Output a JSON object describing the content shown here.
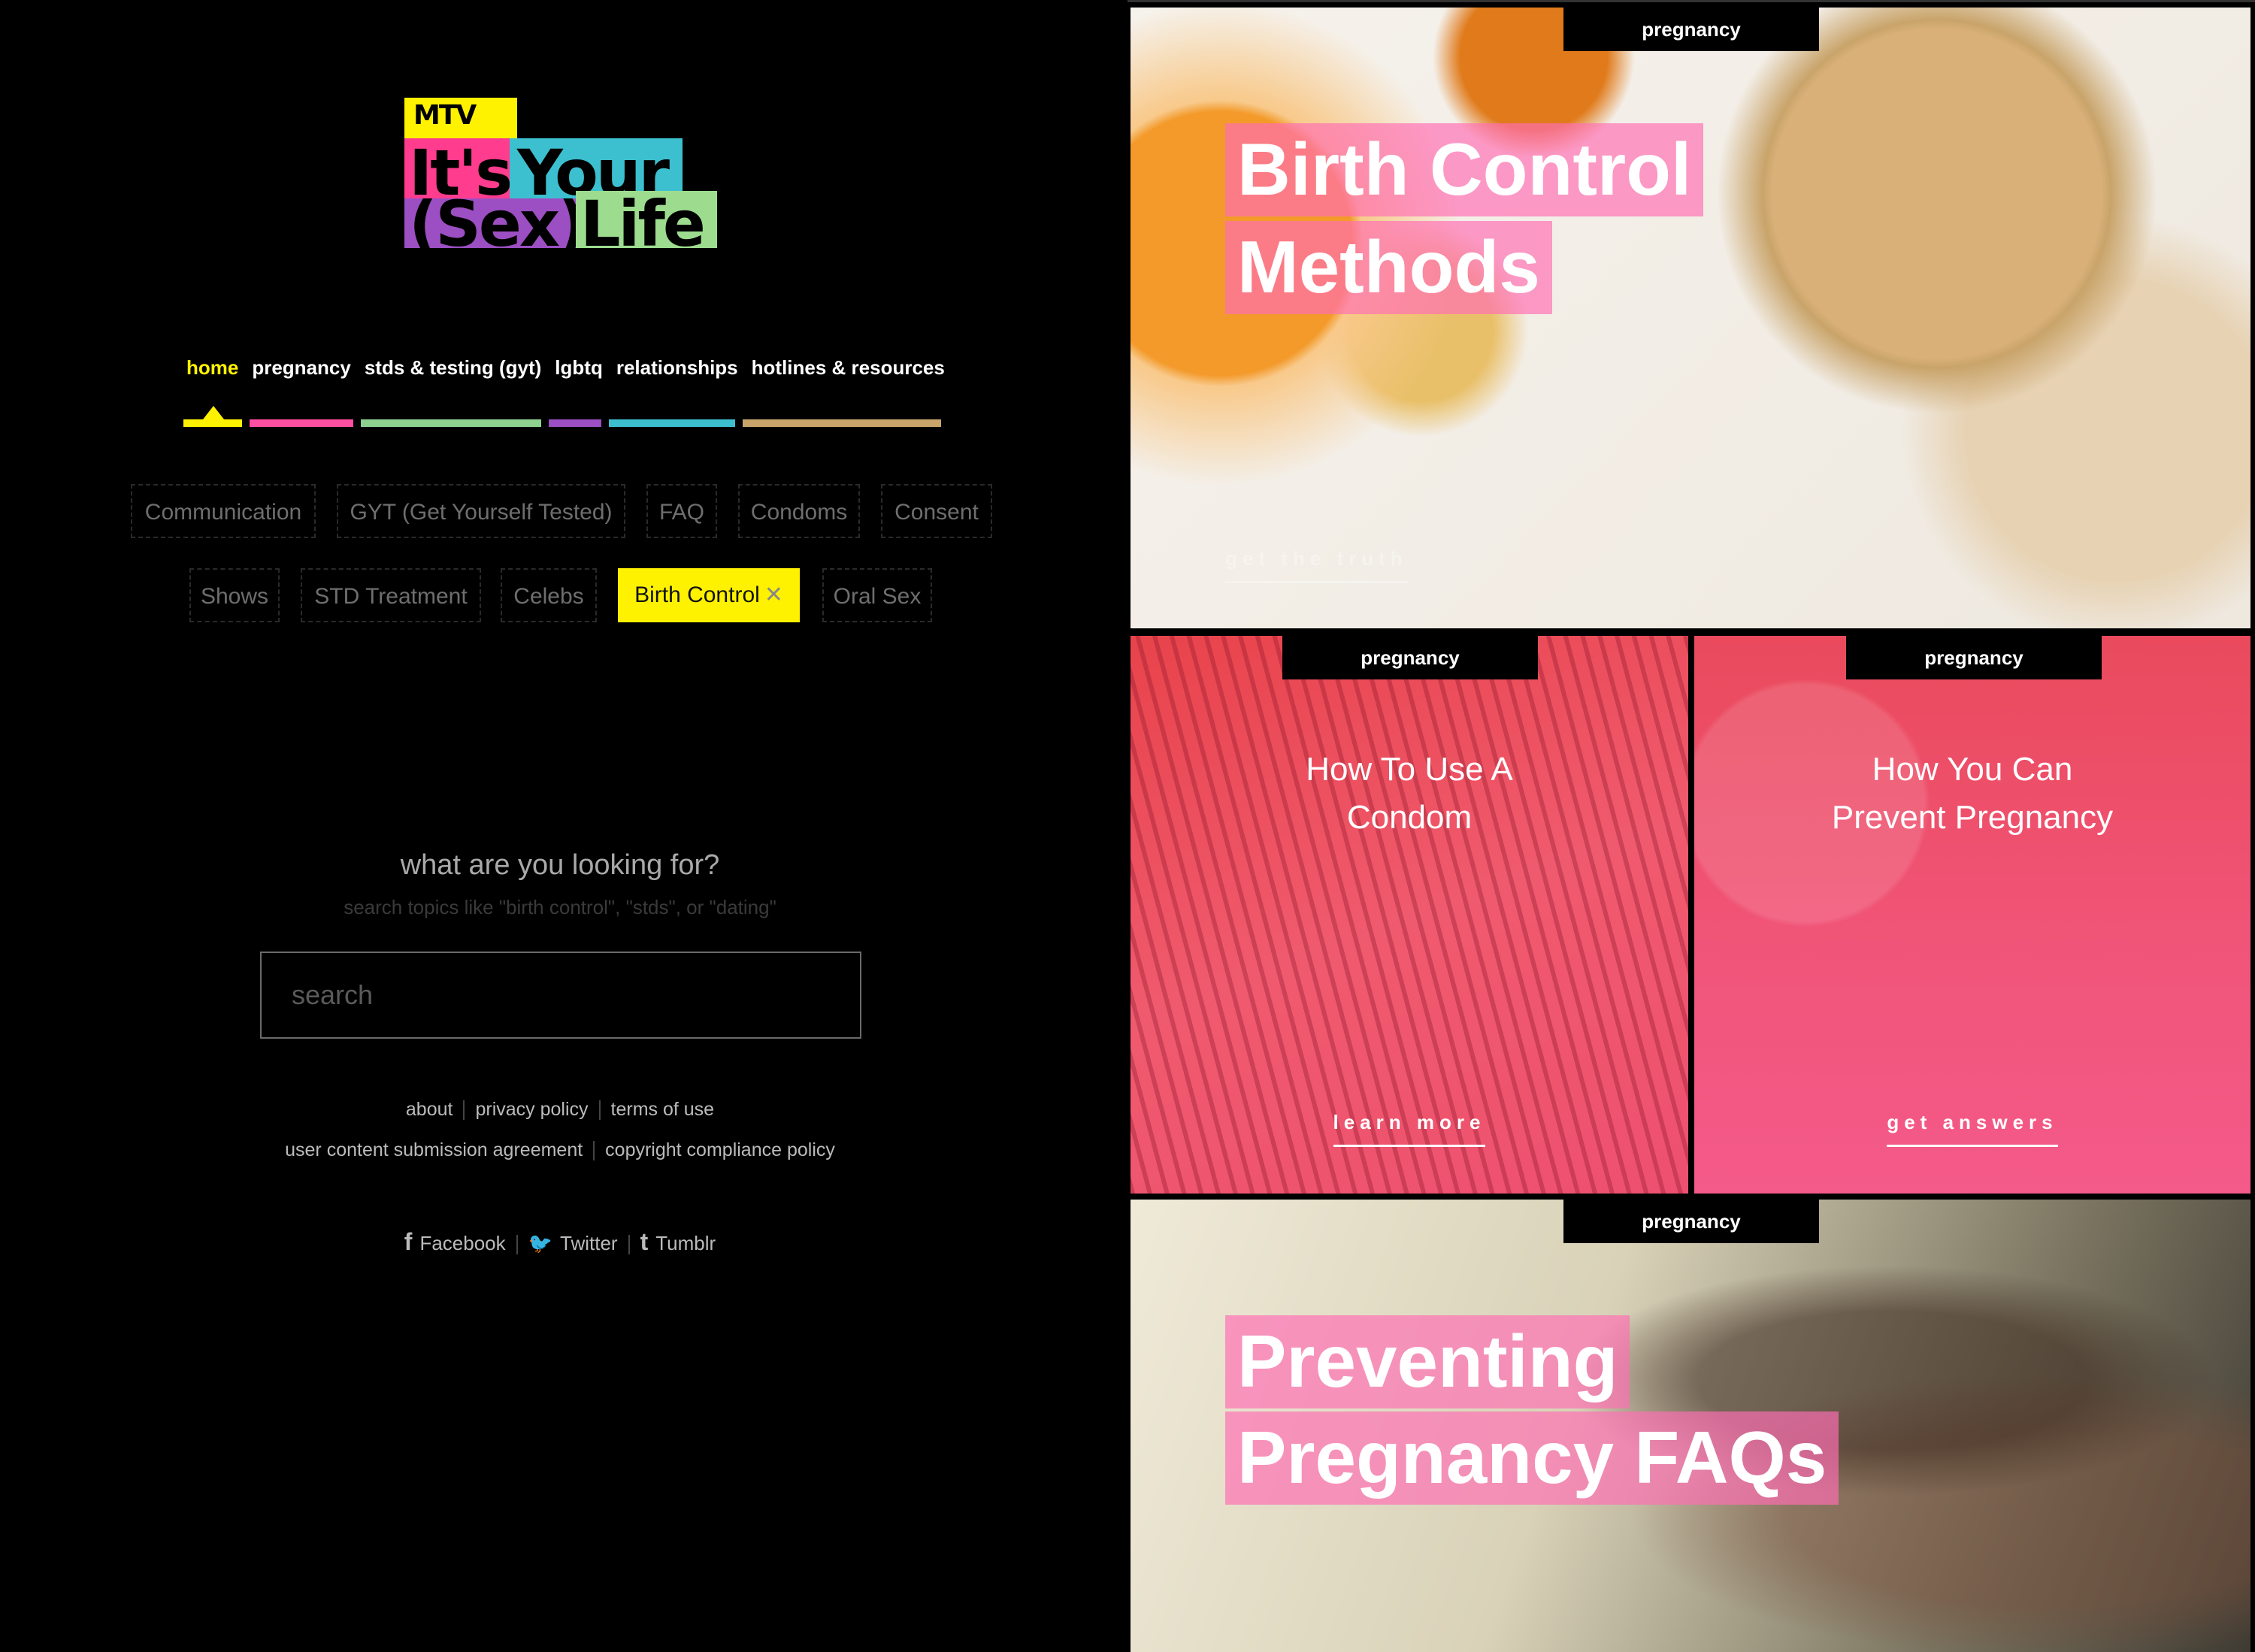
{
  "logo": {
    "brand": "MTV",
    "line1a": "It's",
    "line1b": "Your",
    "line2a": "(Sex)",
    "line2b": "Life",
    "colors": {
      "yellow": "#fff200",
      "pink": "#ff3c8d",
      "teal": "#3cc0cf",
      "purple": "#9b4fc2",
      "green": "#9ddc8f"
    }
  },
  "nav": {
    "items": [
      {
        "label": "home",
        "color": "#fff200",
        "active": true
      },
      {
        "label": "pregnancy",
        "color": "#ff4fa0"
      },
      {
        "label": "stds & testing (gyt)",
        "color": "#8fd18f"
      },
      {
        "label": "lgbtq",
        "color": "#9b4fc2"
      },
      {
        "label": "relationships",
        "color": "#3cc0cf"
      },
      {
        "label": "hotlines & resources",
        "color": "#c8a46a"
      }
    ]
  },
  "tags": {
    "row1": [
      "Communication",
      "GYT (Get Yourself Tested)",
      "FAQ",
      "Condoms",
      "Consent"
    ],
    "row2": [
      "Shows",
      "STD Treatment",
      "Celebs",
      "Birth Control",
      "Oral Sex"
    ],
    "selected": "Birth Control",
    "remove_symbol": "✕"
  },
  "search": {
    "heading": "what are you looking for?",
    "hint": "search topics like \"birth control\", \"stds\", or \"dating\"",
    "placeholder": "search"
  },
  "footer": {
    "about": "about",
    "privacy": "privacy policy",
    "terms": "terms of use",
    "ucsa": "user content submission agreement",
    "copyright": "copyright compliance policy",
    "social": [
      {
        "icon": "facebook-icon",
        "glyph": "f",
        "label": "Facebook"
      },
      {
        "icon": "twitter-icon",
        "glyph": "🐦",
        "label": "Twitter"
      },
      {
        "icon": "tumblr-icon",
        "glyph": "t",
        "label": "Tumblr"
      }
    ]
  },
  "cards": {
    "c1": {
      "badge": "pregnancy",
      "title1": "Birth Control",
      "title2": "Methods",
      "cta": "get the truth"
    },
    "c2": {
      "badge": "pregnancy",
      "title1": "How To Use A",
      "title2": "Condom",
      "cta": "learn more"
    },
    "c3": {
      "badge": "pregnancy",
      "title1": "How You Can",
      "title2": "Prevent Pregnancy",
      "cta": "get answers"
    },
    "c4": {
      "badge": "pregnancy",
      "title1": "Preventing",
      "title2": "Pregnancy FAQs"
    }
  }
}
